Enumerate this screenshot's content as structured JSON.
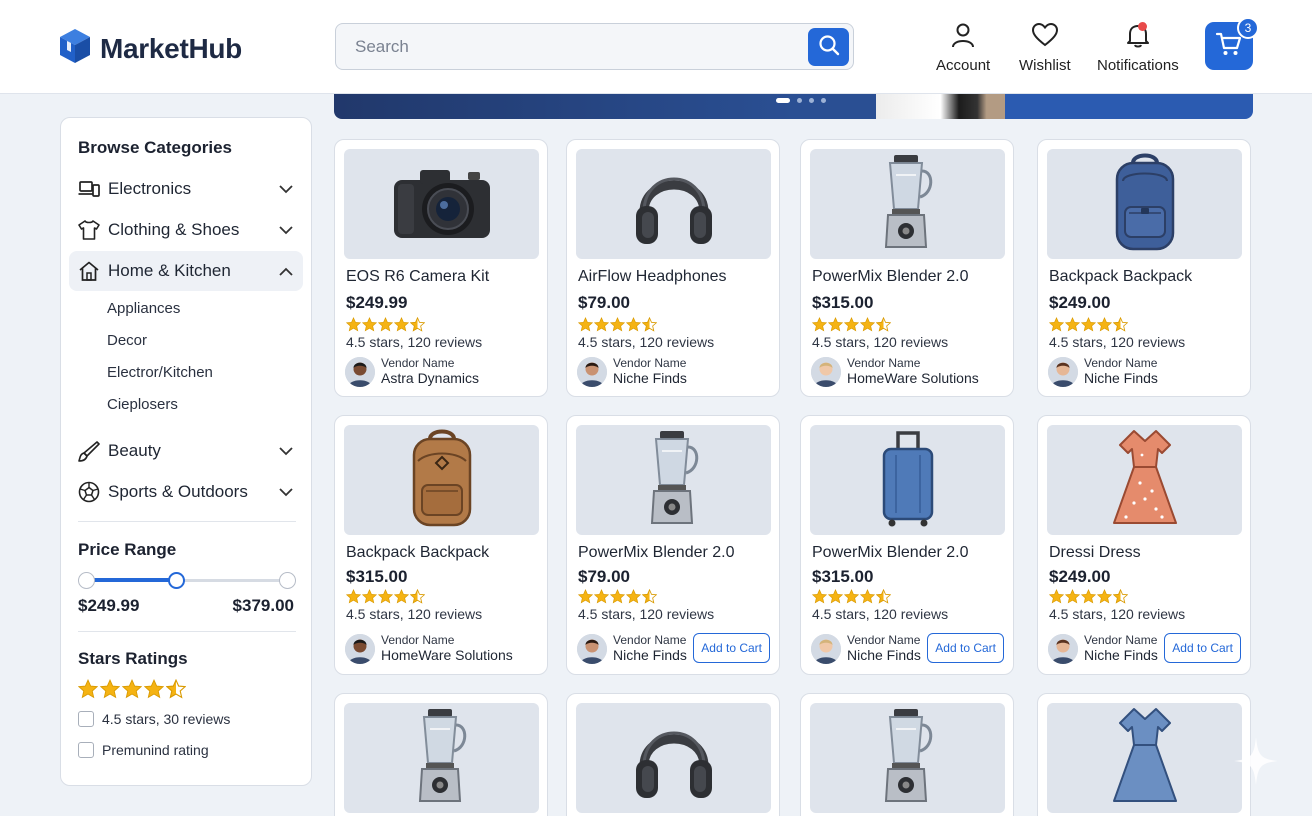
{
  "header": {
    "brand": "MarketHub",
    "search_placeholder": "Search",
    "nav": {
      "account": "Account",
      "wishlist": "Wishlist",
      "notifications": "Notifications"
    },
    "cart_count": "3",
    "accent": "#2468d8"
  },
  "sidebar": {
    "title": "Browse Categories",
    "categories": [
      {
        "label": "Electronics",
        "icon": "laptop-phone-icon"
      },
      {
        "label": "Clothing & Shoes",
        "icon": "tshirt-icon"
      },
      {
        "label": "Home & Kitchen",
        "icon": "home-icon"
      },
      {
        "label": "Beauty",
        "icon": "brush-icon"
      },
      {
        "label": "Sports & Outdoors",
        "icon": "ball-icon"
      }
    ],
    "subcategories": [
      "Appliances",
      "Decor",
      "Electror/Kitchen",
      "Cieplosers"
    ],
    "price_title": "Price Range",
    "price_min": "$249.99",
    "price_max": "$379.00",
    "slider_position": 0.45,
    "ratings_title": "Stars Ratings",
    "ratings_stars": 4.5,
    "rating_options": [
      "4.5 stars, 30 reviews",
      "Premunind rating"
    ]
  },
  "products": [
    {
      "name": "EOS R6 Camera Kit",
      "price": "$249.99",
      "reviews": "4.5 stars, 120 reviews",
      "vendor_label": "Vendor Name",
      "vendor": "Astra Dynamics",
      "image": "camera-icon",
      "add_to_cart": ""
    },
    {
      "name": "AirFlow Headphones",
      "price": "$79.00",
      "reviews": "4.5 stars, 120 reviews",
      "vendor_label": "Vendor Name",
      "vendor": "Niche Finds",
      "image": "headphones-icon",
      "add_to_cart": ""
    },
    {
      "name": "PowerMix Blender 2.0",
      "price": "$315.00",
      "reviews": "4.5 stars, 120 reviews",
      "vendor_label": "Vendor Name",
      "vendor": "HomeWare Solutions",
      "image": "blender-icon",
      "add_to_cart": ""
    },
    {
      "name": "Backpack Backpack",
      "price": "$249.00",
      "reviews": "4.5 stars, 120 reviews",
      "vendor_label": "Vendor Name",
      "vendor": "Niche Finds",
      "image": "backpack-blue-icon",
      "add_to_cart": ""
    },
    {
      "name": "Backpack Backpack",
      "price": "$315.00",
      "reviews": "4.5 stars, 120 reviews",
      "vendor_label": "Vendor Name",
      "vendor": "HomeWare Solutions",
      "image": "backpack-brown-icon",
      "add_to_cart": ""
    },
    {
      "name": "PowerMix Blender 2.0",
      "price": "$79.00",
      "reviews": "4.5 stars, 120 reviews",
      "vendor_label": "Vendor Name",
      "vendor": "Niche Finds",
      "image": "blender-icon",
      "add_to_cart": "Add to Cart"
    },
    {
      "name": "PowerMix Blender 2.0",
      "price": "$315.00",
      "reviews": "4.5 stars, 120 reviews",
      "vendor_label": "Vendor Name",
      "vendor": "Niche Finds",
      "image": "suitcase-icon",
      "add_to_cart": "Add to Cart"
    },
    {
      "name": "Dressi Dress",
      "price": "$249.00",
      "reviews": "4.5 stars, 120 reviews",
      "vendor_label": "Vendor Name",
      "vendor": "Niche Finds",
      "image": "dress-orange-icon",
      "add_to_cart": "Add to Cart"
    }
  ],
  "partial_products": [
    {
      "image": "blender-icon"
    },
    {
      "image": "headphones-icon"
    },
    {
      "image": "blender-icon"
    },
    {
      "image": "dress-blue-icon"
    }
  ],
  "star_rating": 4.5
}
